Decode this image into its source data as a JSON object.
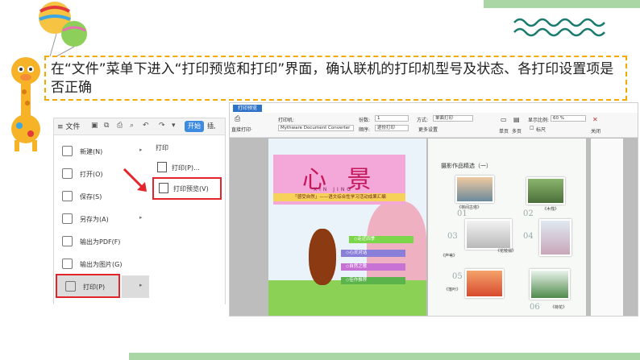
{
  "caption": {
    "text": "在“文件”菜单下进入“打印预览和打印”界面，确认联机的打印机型号及状态、各打印设置项是否正确"
  },
  "left_screenshot": {
    "file_button": "≡ 文件",
    "start_button": "开始",
    "insert_label": "插,",
    "menu_items": [
      {
        "label": "新建(N)",
        "has_arrow": true
      },
      {
        "label": "打开(O)",
        "has_arrow": false
      },
      {
        "label": "保存(S)",
        "has_arrow": false
      },
      {
        "label": "另存为(A)",
        "has_arrow": true
      },
      {
        "label": "输出为PDF(F)",
        "has_arrow": false
      },
      {
        "label": "输出为图片(G)",
        "has_arrow": false
      },
      {
        "label": "打印(P)",
        "has_arrow": true
      }
    ],
    "submenu": {
      "title": "打印",
      "items": [
        {
          "label": "打印(P)..."
        },
        {
          "label": "打印预览(V)"
        }
      ]
    }
  },
  "right_screenshot": {
    "tab_label": "打印预览",
    "toolbar": {
      "direct_print": "直接打印·",
      "printer_label": "打印机:",
      "printer_value": "Mythware Document Converter",
      "copies_label": "份数:",
      "copies_value": "1",
      "order_label": "顺序:",
      "order_value": "逐份打印",
      "mode_label": "方式:",
      "mode_value": "单面打印",
      "more_settings": "更多设置",
      "single_page": "单页",
      "multi_page": "多页",
      "ratio_label": "显示比例:",
      "ratio_value": "60 %",
      "ruler": "标尺",
      "close": "关闭"
    },
    "page_left": {
      "title": "心 景",
      "pinyin": "XIN JING",
      "subtitle": "「感受自然」——语文综合性学习活动成果汇编",
      "menu": [
        "◇走近四季",
        "◇心灵对话",
        "◇自然之歌",
        "◇佳作推荐"
      ]
    },
    "page_right": {
      "heading": "摄影作品精选（一）",
      "numbers": [
        "01",
        "02",
        "03",
        "04",
        "05",
        "06"
      ],
      "captions": [
        "《林间古塔》",
        "《木栈》",
        "《芦苇》",
        "《花枝俏》",
        "《落叶》",
        "《荷花》"
      ]
    }
  },
  "colors": {
    "caption_border": "#f2a900",
    "highlight": "#e3242b",
    "accent": "#2f73c9"
  }
}
